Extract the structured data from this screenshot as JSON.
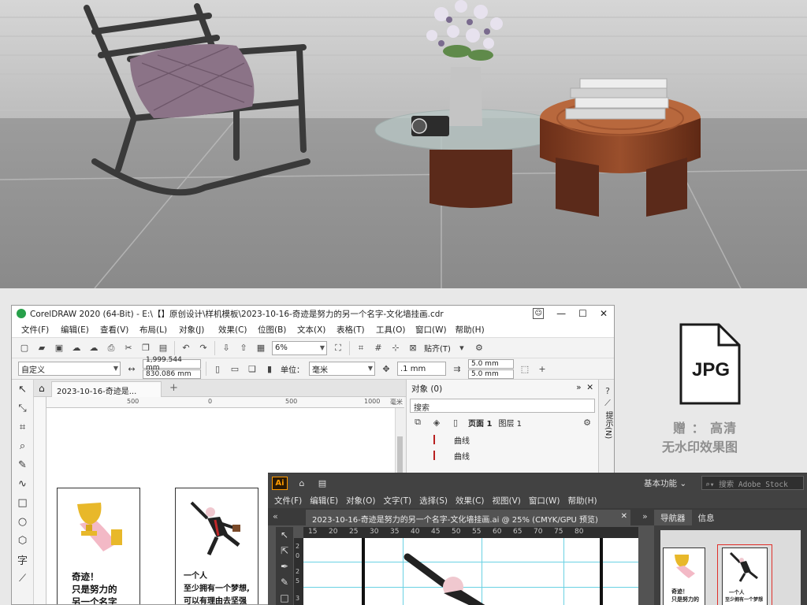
{
  "coreldraw": {
    "title": "CorelDRAW 2020 (64-Bit) - E:\\【】原创设计\\样机模板\\2023-10-16-奇迹是努力的另一个名字-文化墙挂画.cdr",
    "window_controls": [
      "?",
      "—",
      "☐",
      "✕"
    ],
    "menu": [
      "文件(F)",
      "编辑(E)",
      "查看(V)",
      "布局(L)",
      "对象(J)",
      "效果(C)",
      "位图(B)",
      "文本(X)",
      "表格(T)",
      "工具(O)",
      "窗口(W)",
      "帮助(H)"
    ],
    "zoom": "6%",
    "snap_label": "贴齐(T)",
    "page_preset": "自定义",
    "width_value": "1,999.544 mm",
    "height_value": "830.086 mm",
    "units_label": "单位：",
    "units_value": "毫米",
    "nudge_value": ".1 mm",
    "dup_x": "5.0 mm",
    "dup_y": "5.0 mm",
    "doc_tab": "2023-10-16-奇迹是...",
    "ruler_ticks": [
      "500",
      "0",
      "500",
      "1000",
      "毫米"
    ],
    "cards": {
      "left_text": [
        "奇迹！",
        "只是努力的",
        "另一个名字"
      ],
      "right_text": [
        "一个人",
        "至少拥有一个梦想,",
        "可以有理由去坚强"
      ]
    },
    "objects_panel": {
      "title": "对象 (0)",
      "search_placeholder": "搜索",
      "page_label": "页面 1",
      "layer_label": "图层 1",
      "items": [
        "曲线",
        "曲线"
      ]
    },
    "dock_tab": "提示(N)"
  },
  "illustrator": {
    "logo": "Ai",
    "workspace": "基本功能",
    "search_placeholder": "搜索 Adobe Stock",
    "menu": [
      "文件(F)",
      "编辑(E)",
      "对象(O)",
      "文字(T)",
      "选择(S)",
      "效果(C)",
      "视图(V)",
      "窗口(W)",
      "帮助(H)"
    ],
    "doc_tab": "2023-10-16-奇迹是努力的另一个名字-文化墙挂画.ai @ 25% (CMYK/GPU 预览)",
    "ruler_ticks": [
      "15",
      "20",
      "25",
      "30",
      "35",
      "40",
      "45",
      "50",
      "55",
      "60",
      "65",
      "70",
      "75",
      "80"
    ],
    "vruler_ticks": [
      "2",
      "0",
      "2",
      "5",
      "3"
    ],
    "panel_tabs": [
      "导航器",
      "信息"
    ],
    "nav_left_text": [
      "奇迹！",
      "只是努力的"
    ],
    "nav_right_text": [
      "一个人",
      "至少拥有一个梦想"
    ]
  },
  "badge": {
    "format": "JPG",
    "line1": "赠 ： 高清",
    "line2": "无水印效果图"
  },
  "colors": {
    "corel_green": "#27a04a",
    "ai_orange": "#ff9a00",
    "trophy_gold": "#e8b82a",
    "guide_cyan": "#6ad1e3"
  }
}
